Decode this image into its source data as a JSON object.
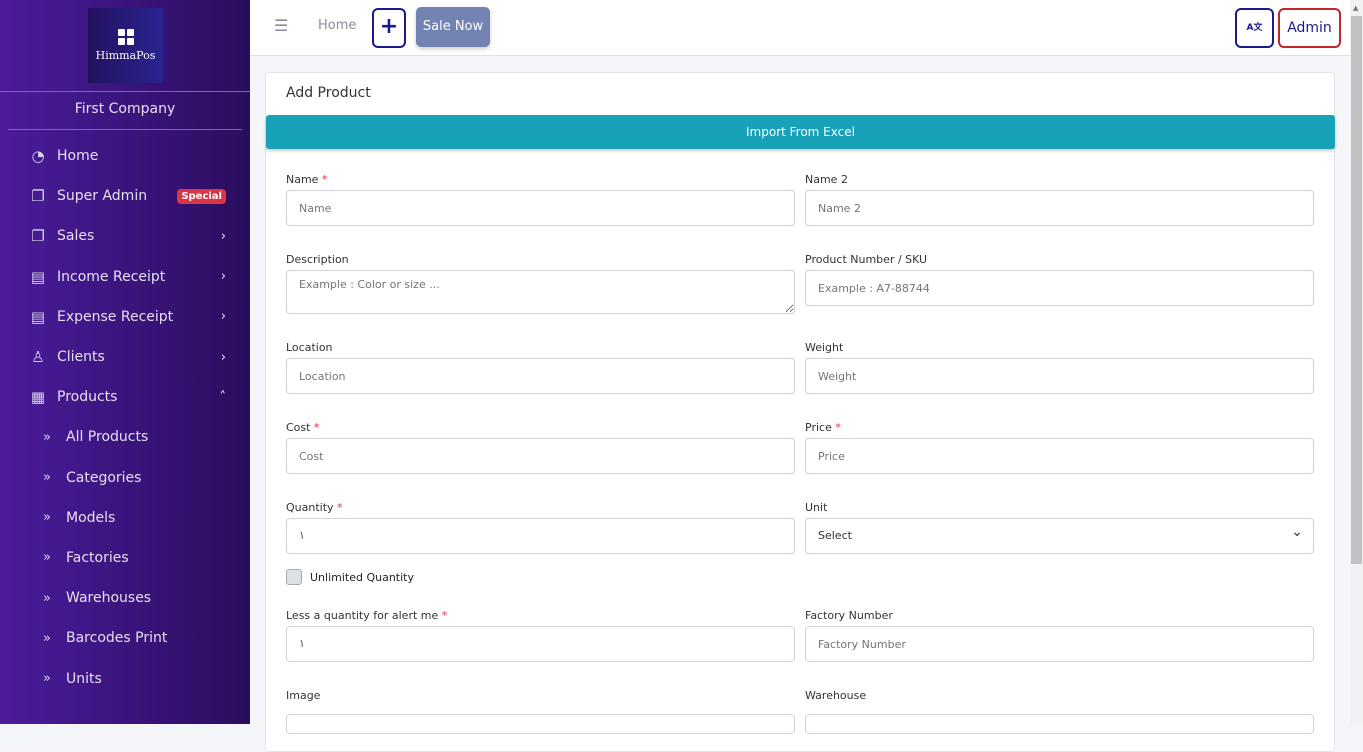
{
  "sidebar": {
    "brand": "HimmaPos",
    "company": "First Company",
    "items": [
      {
        "label": "Home",
        "icon": "dashboard-icon"
      },
      {
        "label": "Super Admin",
        "icon": "copy-icon",
        "badge": "Special"
      },
      {
        "label": "Sales",
        "icon": "copy-icon"
      },
      {
        "label": "Income Receipt",
        "icon": "money-icon"
      },
      {
        "label": "Expense Receipt",
        "icon": "money-icon"
      },
      {
        "label": "Clients",
        "icon": "user-icon"
      },
      {
        "label": "Products",
        "icon": "grid-icon"
      }
    ],
    "sub_items": [
      "All Products",
      "Categories",
      "Models",
      "Factories",
      "Warehouses",
      "Barcodes Print",
      "Units"
    ]
  },
  "topbar": {
    "home": "Home",
    "plus": "+",
    "sale_now": "Sale Now",
    "lang": "A文",
    "admin": "Admin"
  },
  "form": {
    "title": "Add Product",
    "import": "Import From Excel",
    "name": {
      "label": "Name",
      "req": "*",
      "placeholder": "Name"
    },
    "name2": {
      "label": "Name 2",
      "placeholder": "Name 2"
    },
    "description": {
      "label": "Description",
      "placeholder": "Example : Color or size ..."
    },
    "sku": {
      "label": "Product Number / SKU",
      "placeholder": "Example : A7-88744"
    },
    "location": {
      "label": "Location",
      "placeholder": "Location"
    },
    "weight": {
      "label": "Weight",
      "placeholder": "Weight"
    },
    "cost": {
      "label": "Cost",
      "req": "*",
      "placeholder": "Cost"
    },
    "price": {
      "label": "Price",
      "req": "*",
      "placeholder": "Price"
    },
    "quantity": {
      "label": "Quantity",
      "req": "*",
      "value": "١"
    },
    "unit": {
      "label": "Unit",
      "value": "Select"
    },
    "unlimited": "Unlimited Quantity",
    "alert": {
      "label": "Less a quantity for alert me",
      "req": "*",
      "value": "١"
    },
    "factory": {
      "label": "Factory Number",
      "placeholder": "Factory Number"
    },
    "image": {
      "label": "Image"
    },
    "warehouse": {
      "label": "Warehouse"
    }
  }
}
